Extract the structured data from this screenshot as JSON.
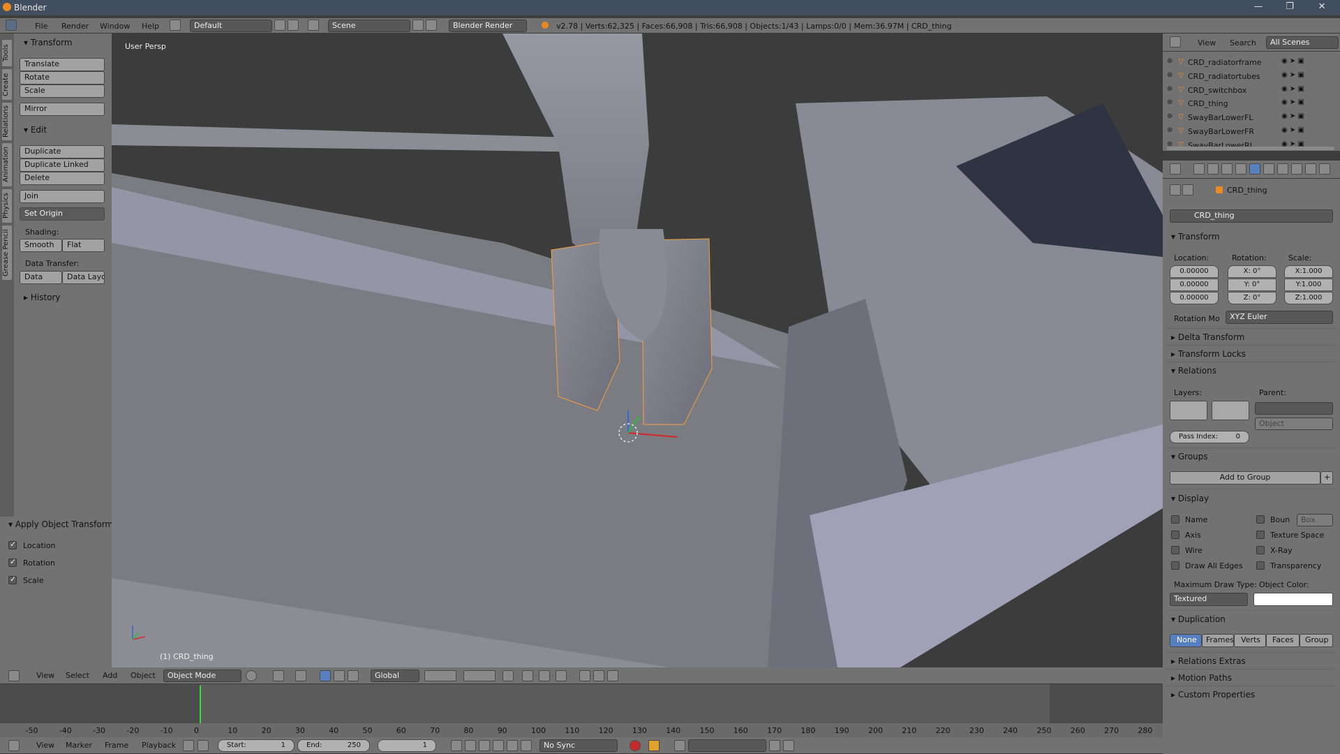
{
  "window": {
    "title": "Blender",
    "controls": [
      "—",
      "❐",
      "✕"
    ]
  },
  "menubar": {
    "items": [
      "File",
      "Render",
      "Window",
      "Help"
    ],
    "screen": "Default",
    "scene": "Scene",
    "engine": "Blender Render",
    "stats": "v2.78 | Verts:62,325 | Faces:66,908 | Tris:66,908 | Objects:1/43 | Lamps:0/0 | Mem:36.97M | CRD_thing"
  },
  "toolshelf": {
    "tabs": [
      "Tools",
      "Create",
      "Relations",
      "Animation",
      "Physics",
      "Grease Pencil"
    ],
    "transform": {
      "header": "Transform",
      "buttons": [
        "Translate",
        "Rotate",
        "Scale",
        "Mirror"
      ]
    },
    "edit": {
      "header": "Edit",
      "buttons": [
        "Duplicate",
        "Duplicate Linked",
        "Delete",
        "Join"
      ],
      "set_origin": "Set Origin",
      "shading_label": "Shading:",
      "smooth": "Smooth",
      "flat": "Flat",
      "data_transfer_label": "Data Transfer:",
      "data": "Data",
      "data_layout": "Data Layo"
    },
    "history": "History"
  },
  "operator": {
    "header": "Apply Object Transform",
    "options": [
      {
        "label": "Location",
        "checked": true
      },
      {
        "label": "Rotation",
        "checked": true
      },
      {
        "label": "Scale",
        "checked": true
      }
    ]
  },
  "viewport": {
    "view_label": "User Persp",
    "object_label": "(1) CRD_thing"
  },
  "viewport_header": {
    "menus": [
      "View",
      "Select",
      "Add",
      "Object"
    ],
    "mode": "Object Mode",
    "orientation": "Global"
  },
  "outliner": {
    "menus": [
      "View",
      "Search"
    ],
    "filter": "All Scenes",
    "items": [
      "CRD_radiatorframe",
      "CRD_radiatortubes",
      "CRD_switchbox",
      "CRD_thing",
      "SwayBarLowerFL",
      "SwayBarLowerFR",
      "SwayBarLowerRL"
    ]
  },
  "properties": {
    "breadcrumb": "CRD_thing",
    "object_name": "CRD_thing",
    "transform": {
      "header": "Transform",
      "location_label": "Location:",
      "rotation_label": "Rotation:",
      "scale_label": "Scale:",
      "location": [
        "0.00000",
        "0.00000",
        "0.00000"
      ],
      "rotation": [
        "X:",
        "Y:",
        "Z:"
      ],
      "rotation_values": [
        "0°",
        "0°",
        "0°"
      ],
      "scale": [
        "X:1.000",
        "Y:1.000",
        "Z:1.000"
      ],
      "rotation_mode_label": "Rotation Mo",
      "rotation_mode": "XYZ Euler"
    },
    "delta_transform": "Delta Transform",
    "transform_locks": "Transform Locks",
    "relations": {
      "header": "Relations",
      "layers_label": "Layers:",
      "parent_label": "Parent:",
      "parent_type": "Object",
      "pass_index_label": "Pass Index:",
      "pass_index": "0"
    },
    "groups": {
      "header": "Groups",
      "add_button": "Add to Group"
    },
    "display": {
      "header": "Display",
      "left": [
        "Name",
        "Axis",
        "Wire",
        "Draw All Edges"
      ],
      "right": [
        "Boun",
        "Texture Space",
        "X-Ray",
        "Transparency"
      ],
      "bounds_type": "Box",
      "max_draw_label": "Maximum Draw Type:",
      "max_draw": "Textured",
      "object_color_label": "Object Color:",
      "object_color": "#ffffff"
    },
    "duplication": {
      "header": "Duplication",
      "options": [
        "None",
        "Frames",
        "Verts",
        "Faces",
        "Group"
      ],
      "active": "None"
    },
    "collapsed": [
      "Relations Extras",
      "Motion Paths",
      "Custom Properties"
    ]
  },
  "timeline": {
    "ticks": [
      "-50",
      "-40",
      "-30",
      "-20",
      "-10",
      "0",
      "10",
      "20",
      "30",
      "40",
      "50",
      "60",
      "70",
      "80",
      "90",
      "100",
      "110",
      "120",
      "130",
      "140",
      "150",
      "160",
      "170",
      "180",
      "190",
      "200",
      "210",
      "220",
      "230",
      "240",
      "250",
      "260",
      "270",
      "280"
    ],
    "current_frame": 0,
    "menus": [
      "View",
      "Marker",
      "Frame",
      "Playback"
    ],
    "start_label": "Start:",
    "start": "1",
    "end_label": "End:",
    "end": "250",
    "frame": "1",
    "sync": "No Sync"
  },
  "colors": {
    "accent": "#5680c2",
    "selection": "#f2a13c"
  }
}
